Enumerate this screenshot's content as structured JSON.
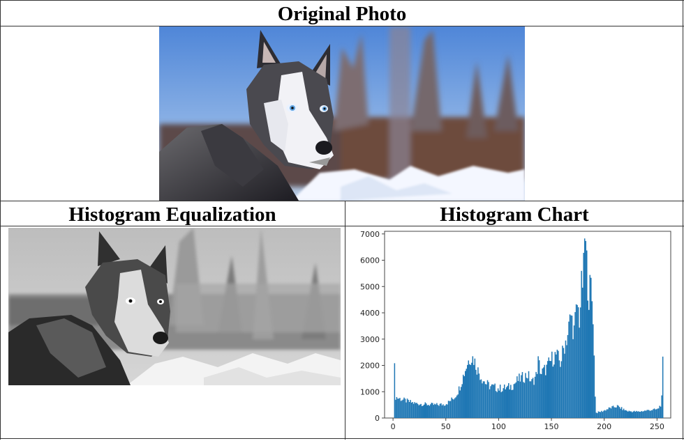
{
  "headers": {
    "original": "Original Photo",
    "equalized": "Histogram Equalization",
    "chart": "Histogram Chart"
  },
  "colors": {
    "bar": "#1f77b4",
    "border": "#333333"
  },
  "chart_data": {
    "type": "bar",
    "title": "",
    "xlabel": "",
    "ylabel": "",
    "xlim": [
      -8,
      263
    ],
    "ylim": [
      0,
      7100
    ],
    "xticks": [
      0,
      50,
      100,
      150,
      200,
      250
    ],
    "yticks": [
      0,
      1000,
      2000,
      3000,
      4000,
      5000,
      6000,
      7000
    ],
    "grid": false,
    "legend": "none",
    "profile": [
      [
        0,
        0
      ],
      [
        1,
        1850
      ],
      [
        2,
        800
      ],
      [
        5,
        750
      ],
      [
        10,
        680
      ],
      [
        20,
        560
      ],
      [
        30,
        520
      ],
      [
        40,
        500
      ],
      [
        48,
        520
      ],
      [
        52,
        600
      ],
      [
        58,
        800
      ],
      [
        62,
        1100
      ],
      [
        66,
        1600
      ],
      [
        70,
        2100
      ],
      [
        73,
        2350
      ],
      [
        76,
        2250
      ],
      [
        80,
        1800
      ],
      [
        84,
        1500
      ],
      [
        88,
        1300
      ],
      [
        92,
        1200
      ],
      [
        100,
        1120
      ],
      [
        108,
        1150
      ],
      [
        113,
        1250
      ],
      [
        118,
        1450
      ],
      [
        123,
        1550
      ],
      [
        127,
        1650
      ],
      [
        131,
        1350
      ],
      [
        135,
        1600
      ],
      [
        137,
        2150
      ],
      [
        140,
        1700
      ],
      [
        145,
        1900
      ],
      [
        150,
        2250
      ],
      [
        154,
        2400
      ],
      [
        158,
        2100
      ],
      [
        162,
        2800
      ],
      [
        165,
        3200
      ],
      [
        168,
        3900
      ],
      [
        171,
        3300
      ],
      [
        174,
        4300
      ],
      [
        176,
        3800
      ],
      [
        178,
        4900
      ],
      [
        180,
        5500
      ],
      [
        181,
        6900
      ],
      [
        183,
        5800
      ],
      [
        185,
        4700
      ],
      [
        187,
        5000
      ],
      [
        189,
        4000
      ],
      [
        190,
        2300
      ],
      [
        191,
        900
      ],
      [
        192,
        200
      ],
      [
        198,
        260
      ],
      [
        205,
        380
      ],
      [
        212,
        450
      ],
      [
        218,
        320
      ],
      [
        222,
        260
      ],
      [
        232,
        240
      ],
      [
        242,
        300
      ],
      [
        250,
        330
      ],
      [
        253,
        500
      ],
      [
        254,
        750
      ],
      [
        255,
        2050
      ],
      [
        256,
        0
      ]
    ]
  }
}
